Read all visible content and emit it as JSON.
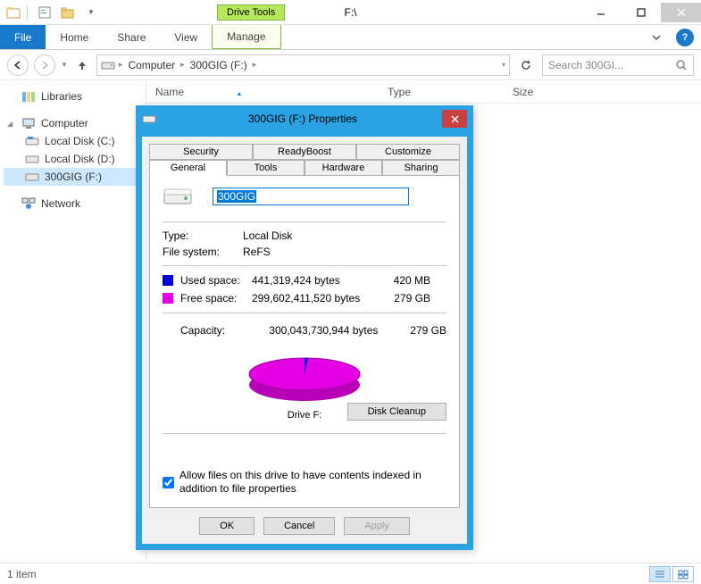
{
  "window": {
    "tool_tab": "Drive Tools",
    "title": "F:\\",
    "ribbon": {
      "file": "File",
      "home": "Home",
      "share": "Share",
      "view": "View",
      "manage": "Manage"
    }
  },
  "breadcrumbs": {
    "computer": "Computer",
    "drive": "300GIG (F:)"
  },
  "search": {
    "placeholder": "Search 300GI..."
  },
  "nav": {
    "libraries": "Libraries",
    "computer": "Computer",
    "local_c": "Local Disk (C:)",
    "local_d": "Local Disk (D:)",
    "drive_f": "300GIG (F:)",
    "network": "Network"
  },
  "columns": {
    "name": "Name",
    "type": "Type",
    "size": "Size"
  },
  "status": {
    "items": "1 item"
  },
  "dialog": {
    "title": "300GIG (F:) Properties",
    "tabs": {
      "security": "Security",
      "readyboost": "ReadyBoost",
      "customize": "Customize",
      "general": "General",
      "tools": "Tools",
      "hardware": "Hardware",
      "sharing": "Sharing"
    },
    "drive_name": "300GIG",
    "type_label": "Type:",
    "type_value": "Local Disk",
    "fs_label": "File system:",
    "fs_value": "ReFS",
    "used_label": "Used space:",
    "used_bytes": "441,319,424 bytes",
    "used_hr": "420 MB",
    "free_label": "Free space:",
    "free_bytes": "299,602,411,520 bytes",
    "free_hr": "279 GB",
    "capacity_label": "Capacity:",
    "capacity_bytes": "300,043,730,944 bytes",
    "capacity_hr": "279 GB",
    "pie_label": "Drive F:",
    "cleanup": "Disk Cleanup",
    "index_label": "Allow files on this drive to have contents indexed in addition to file properties",
    "ok": "OK",
    "cancel": "Cancel",
    "apply": "Apply"
  },
  "chart_data": {
    "type": "pie",
    "title": "Drive F:",
    "series": [
      {
        "name": "Used space",
        "value": 441319424,
        "color": "#0000d8"
      },
      {
        "name": "Free space",
        "value": 299602411520,
        "color": "#e400e4"
      }
    ]
  }
}
